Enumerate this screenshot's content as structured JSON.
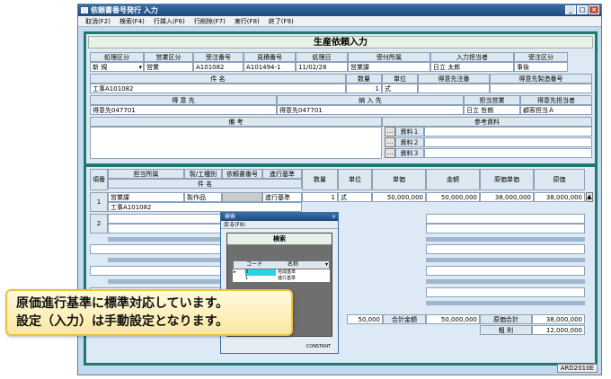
{
  "window": {
    "title": "依頼書番号発行 入力",
    "status_code": "ARD2010E"
  },
  "menu": [
    "取消(F2)",
    "検索(F4)",
    "行挿入(F6)",
    "行削除(F7)",
    "実行(F8)",
    "終了(F9)"
  ],
  "form": {
    "title": "生産依頼入力",
    "row1_labels": [
      "処理区分",
      "営業区分",
      "受注番号",
      "見積番号",
      "処理日",
      "受付所属",
      "入力担当者",
      "受注区分"
    ],
    "row1_values": [
      "新 規",
      "営業",
      "A101082",
      "A101494-1",
      "11/02/28",
      "営業課",
      "日立  太郎",
      "事後"
    ],
    "item_labels": [
      "件  名",
      "数量",
      "単位",
      "得意先注番",
      "得意先製造番号"
    ],
    "item_values": [
      "工事A101082",
      "1",
      "式",
      "",
      ""
    ],
    "customer_labels": [
      "得  意  先",
      "納  入  先",
      "担当営業",
      "得意先担当者"
    ],
    "customer_values": [
      "得意先047701",
      "得意先047701",
      "日立  哲朗",
      "顧客担当Ａ"
    ],
    "remarks_label": "備  考",
    "ref_label": "参考資料",
    "ref_items": [
      "資料１",
      "資料２",
      "資料３"
    ]
  },
  "detail": {
    "headers": [
      "項番",
      "担当所属",
      "製/工種別",
      "依頼書番号",
      "進行基準",
      "数量",
      "単位",
      "単価",
      "金額",
      "原価単価",
      "原価"
    ],
    "subheader": "件  名",
    "row1": {
      "no": "1",
      "dept": "営業課",
      "type": "製作品",
      "basis": "進行基準",
      "qty": "1",
      "unit": "式",
      "price": "50,000,000",
      "amount": "50,000,000",
      "cost_price": "38,000,000",
      "cost": "38,000,000",
      "item": "工事A101082"
    },
    "row2_no": "2"
  },
  "totals": {
    "amount": "50,000",
    "total_label": "合計金額",
    "total": "50,000,000",
    "cost_total_label": "原価合計",
    "cost_total": "38,000,000",
    "profit_label": "粗  利",
    "profit": "12,000,000"
  },
  "popup": {
    "title": "検索",
    "menu": "戻る(F9)",
    "heading": "検索",
    "col_code": "コード",
    "col_name": "名称",
    "rows": [
      {
        "code": "0",
        "name": "完成基準"
      },
      {
        "code": "1",
        "name": "進行基準"
      }
    ],
    "footer": "CONSTANT"
  },
  "callout": {
    "line1": "原価進行基準に標準対応しています。",
    "line2": "設定（入力）は手動設定となります。"
  }
}
